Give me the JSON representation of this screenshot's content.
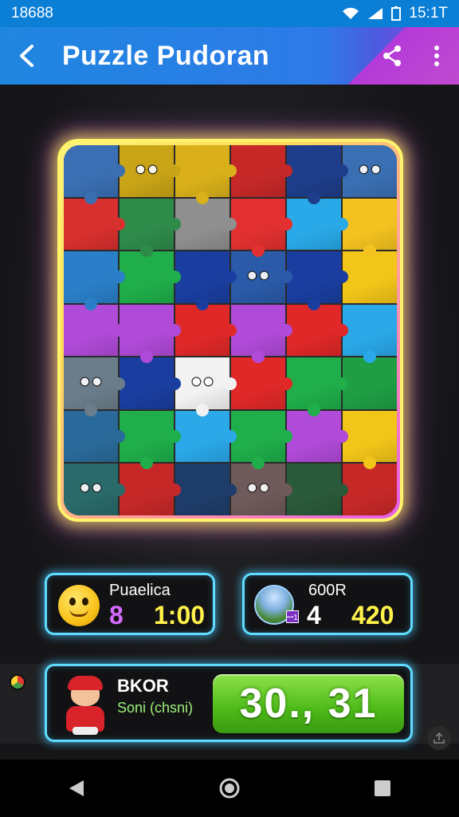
{
  "status": {
    "left_text": "18688",
    "time": "15:1T",
    "icons": [
      "wifi-icon",
      "signal-icon",
      "battery-icon"
    ]
  },
  "app_bar": {
    "title": "Puzzle Pudoran",
    "back_icon": "back-arrow-icon",
    "share_icon": "share-icon",
    "menu_icon": "more-vert-icon"
  },
  "board": {
    "tiles": [
      [
        "#3a6fb3",
        "#c9a416",
        "#d9b01a",
        "#c62828",
        "#1e3d8a",
        "#3a6fb3"
      ],
      [
        "#d8302e",
        "#2e8b4a",
        "#8f8f8f",
        "#e23030",
        "#29a9e8",
        "#f4c21f"
      ],
      [
        "#2a7fc8",
        "#1fae4a",
        "#1a3ea0",
        "#2a5aa8",
        "#1a3ea0",
        "#f2c519"
      ],
      [
        "#b04ad8",
        "#b04ad8",
        "#e02828",
        "#b04ad8",
        "#e02828",
        "#2aa8e8"
      ],
      [
        "#6b7d8a",
        "#1a3ea0",
        "#f2f2f2",
        "#e02828",
        "#1fae4a",
        "#1f9e44"
      ],
      [
        "#2a6a9a",
        "#1fae4a",
        "#2aa8e8",
        "#1fae4a",
        "#b04ad8",
        "#f2c519"
      ],
      [
        "#2a6a6a",
        "#c62828",
        "#1e3d6a",
        "#6e5a5a",
        "#2a5a3a",
        "#c62828"
      ]
    ],
    "face_tiles": [
      [
        0,
        1
      ],
      [
        0,
        5
      ],
      [
        2,
        3
      ],
      [
        4,
        0
      ],
      [
        4,
        2
      ],
      [
        6,
        0
      ],
      [
        6,
        3
      ]
    ]
  },
  "players": [
    {
      "name": "Puaelica",
      "count": "8",
      "time": "1:00",
      "avatar": "smiley-emoji-icon"
    },
    {
      "name": "600R",
      "count": "4",
      "score": "420",
      "avatar": "profile-avatar-icon",
      "badge": "ꟷ1"
    }
  ],
  "current": {
    "name": "BKOR",
    "subtitle": "Soni (chsni)",
    "timer": "30., 31",
    "avatar": "mascot-icon"
  },
  "nav": {
    "back": "nav-back-icon",
    "home": "nav-home-icon",
    "recent": "nav-recent-icon"
  }
}
